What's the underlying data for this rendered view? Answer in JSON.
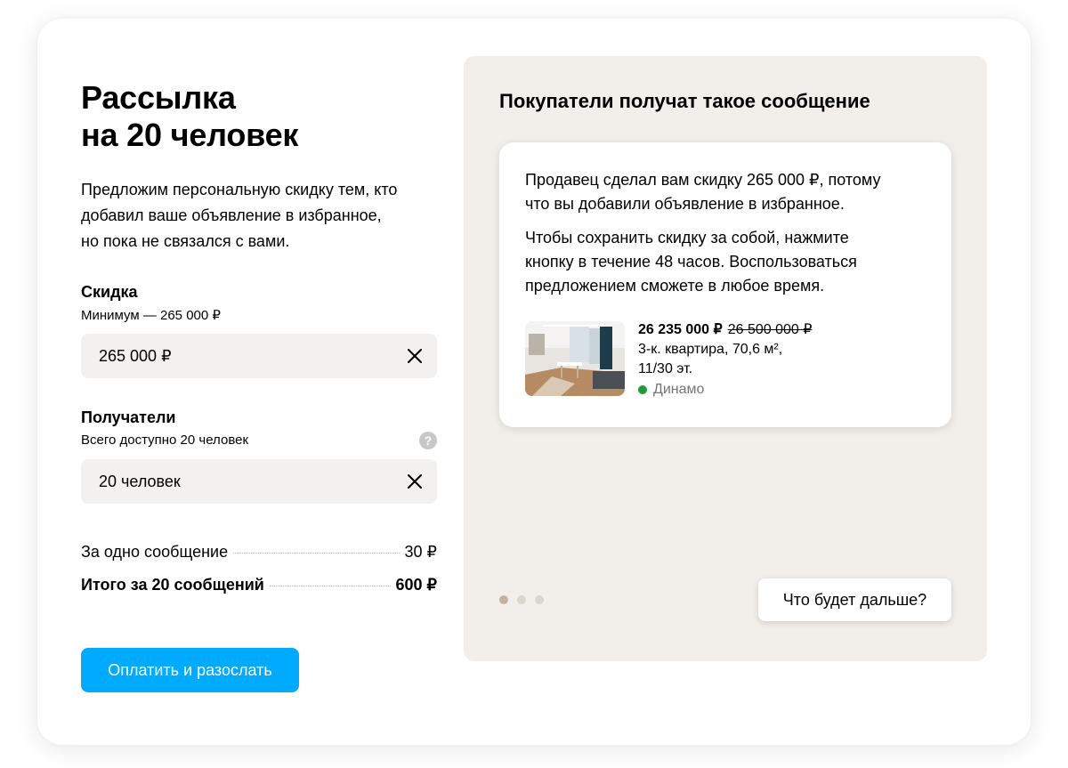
{
  "form": {
    "title_lines": [
      "Рассылка",
      "на 20 человек"
    ],
    "description_lines": [
      "Предложим персональную скидку тем, кто",
      "добавил ваше объявление в избранное,",
      "но пока не связался с вами."
    ],
    "discount": {
      "label": "Скидка",
      "hint": "Минимум — 265 000 ₽",
      "value": "265 000 ₽",
      "clear_icon": "close-icon"
    },
    "recipients": {
      "label": "Получатели",
      "hint": "Всего доступно 20 человек",
      "help_icon": "question-icon",
      "help_glyph": "?",
      "value": "20 человек",
      "clear_icon": "close-icon"
    },
    "summary": {
      "per_message_label": "За одно сообщение",
      "per_message_value": "30 ₽",
      "total_label": "Итого за 20 сообщений",
      "total_value": "600 ₽"
    },
    "pay_button": "Оплатить и разослать"
  },
  "preview": {
    "title": "Покупатели получат такое сообщение",
    "paragraph1_lines": [
      "Продавец сделал вам скидку 265 000 ₽, потому",
      "что вы добавили объявление в избранное."
    ],
    "paragraph2_lines": [
      "Чтобы сохранить скидку за собой, нажмите",
      "кнопку в течение 48 часов. Воспользоваться",
      "предложением сможете в любое время."
    ],
    "ad": {
      "price_new": "26 235 000 ₽",
      "price_old": "26 500 000 ₽",
      "desc_line1": "3-к. квартира, 70,6 м²,",
      "desc_line2": "11/30 эт.",
      "metro": "Динамо",
      "metro_color": "#1f9b38"
    },
    "pager": {
      "count": 3,
      "active": 1
    },
    "next_button": "Что будет дальше?"
  },
  "colors": {
    "accent": "#00aaff",
    "preview_bg": "#f2efea",
    "input_bg": "#f2f1f0"
  }
}
